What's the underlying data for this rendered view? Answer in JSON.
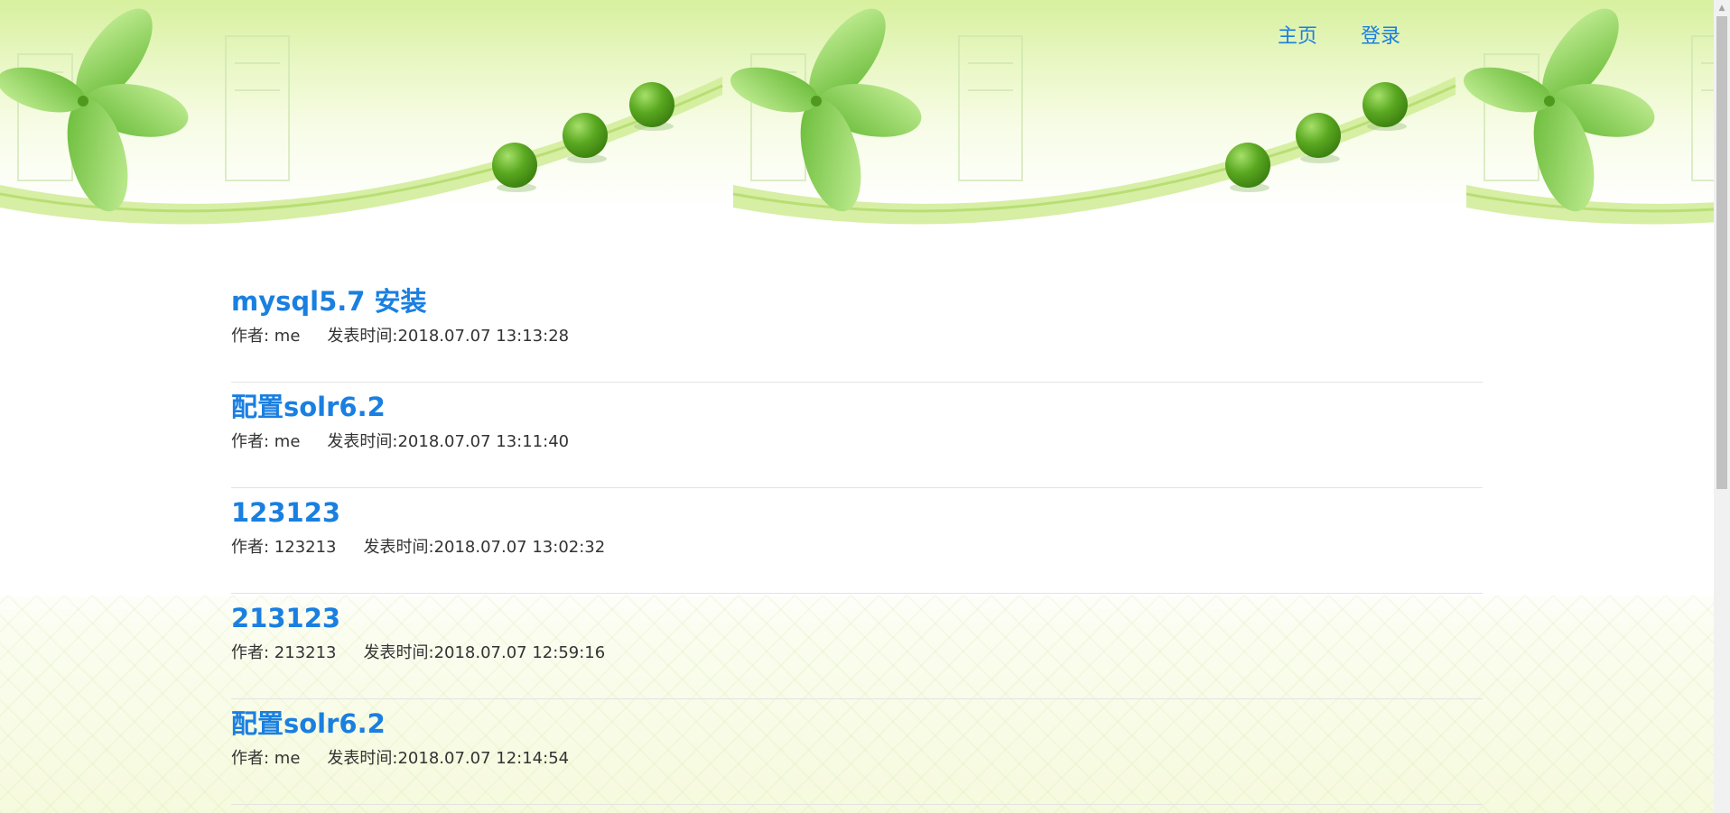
{
  "nav": {
    "home": "主页",
    "login": "登录"
  },
  "posts": [
    {
      "title": "mysql5.7 安装",
      "author_label": "作者: me",
      "time_label": "发表时间:2018.07.07 13:13:28"
    },
    {
      "title": "配置solr6.2",
      "author_label": "作者: me",
      "time_label": "发表时间:2018.07.07 13:11:40"
    },
    {
      "title": "123123",
      "author_label": "作者: 123213",
      "time_label": "发表时间:2018.07.07 13:02:32"
    },
    {
      "title": "213123",
      "author_label": "作者: 213213",
      "time_label": "发表时间:2018.07.07 12:59:16"
    },
    {
      "title": "配置solr6.2",
      "author_label": "作者: me",
      "time_label": "发表时间:2018.07.07 12:14:54"
    }
  ],
  "colors": {
    "link": "#1a7fe0",
    "text": "#333333",
    "leaf": "#7dcf4a",
    "ball": "#5aa821"
  }
}
